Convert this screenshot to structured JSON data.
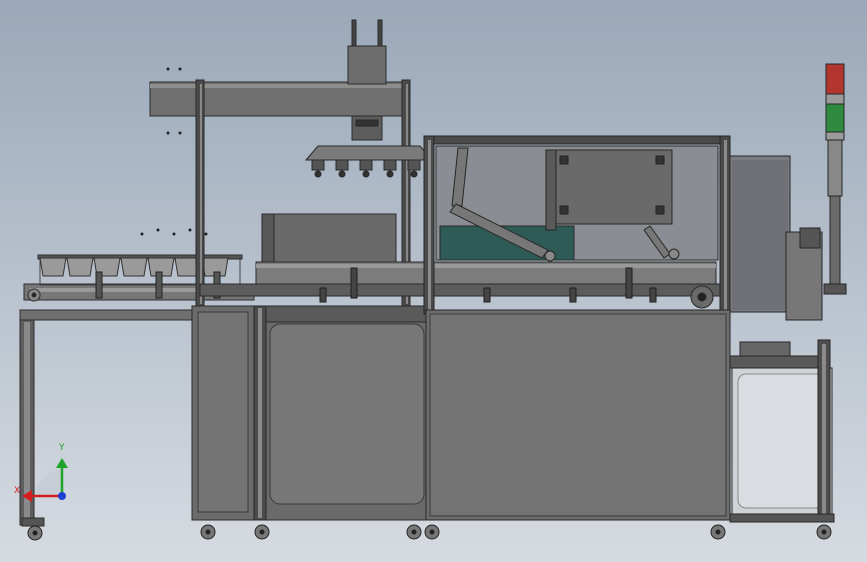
{
  "triad": {
    "x_label": "X",
    "y_label": "Y"
  },
  "colors": {
    "bg_top": "#9aa8b9",
    "bg_bottom": "#d4d9df",
    "frame": "#3a3a3a",
    "panel": "#6e6e6e",
    "panel_dark": "#555555",
    "panel_light": "#8a8a8a",
    "glass": "#7d7f84",
    "teal": "#2f5b57",
    "lamp_red": "#b3362e",
    "lamp_green": "#2e8a3e",
    "axis_x": "#d21e1e",
    "axis_y": "#1fa32a",
    "axis_z": "#1f3fd2"
  }
}
